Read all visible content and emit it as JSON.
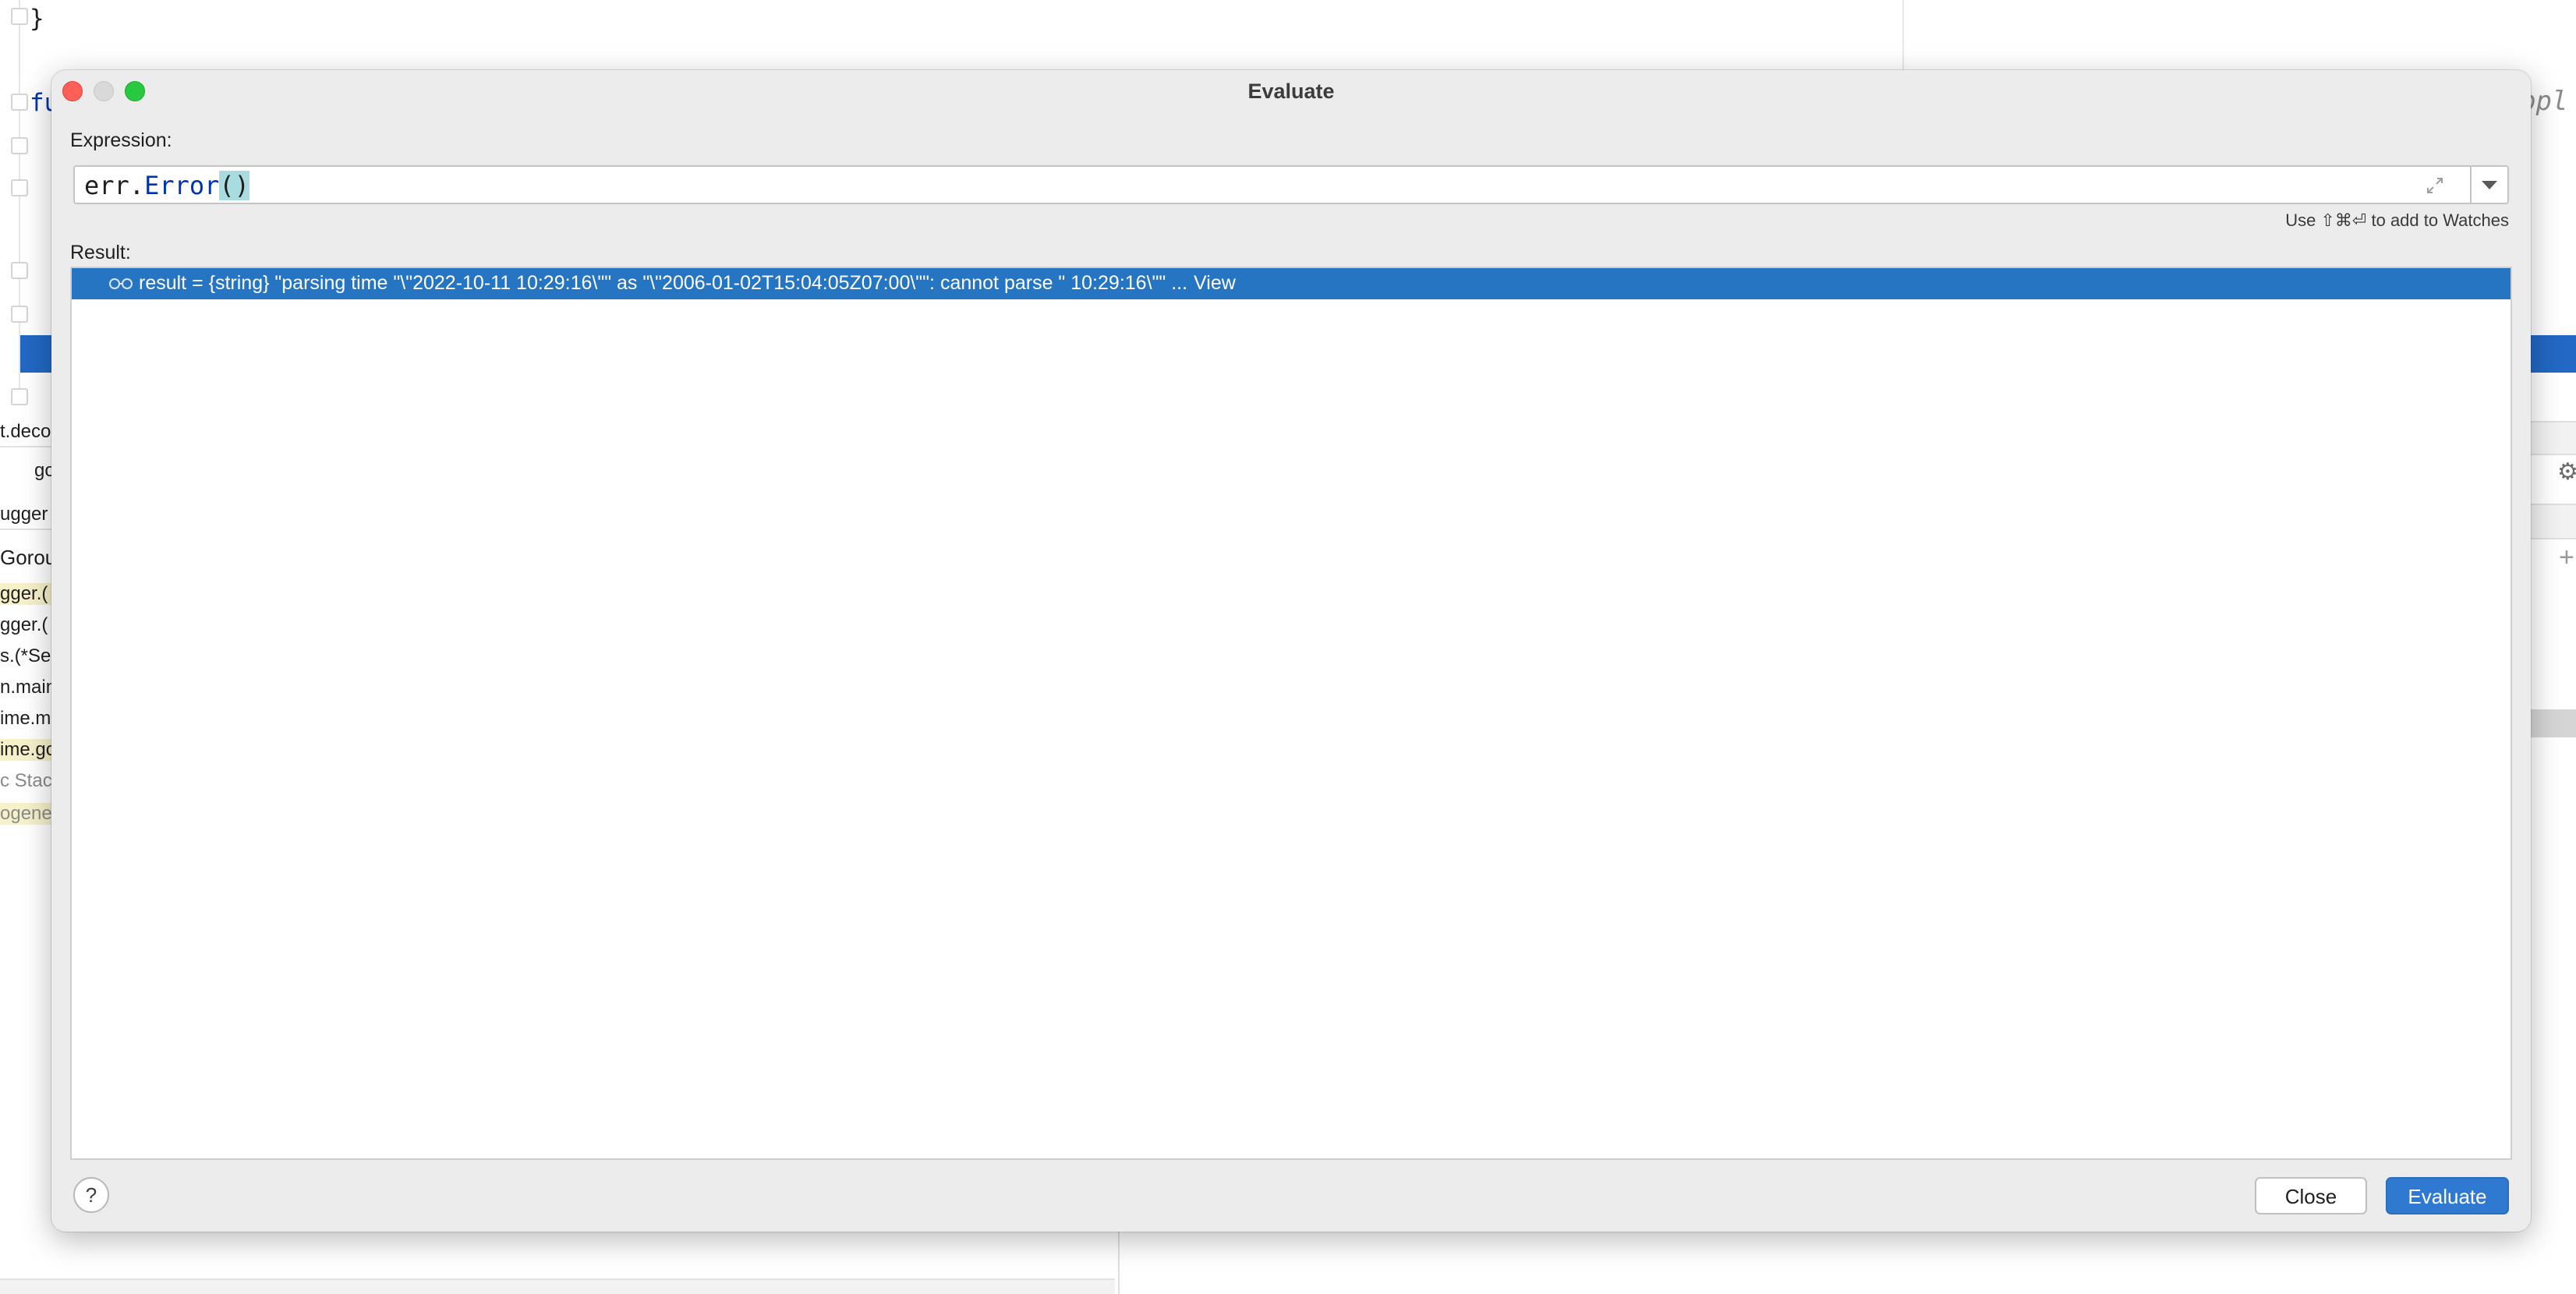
{
  "background_ide": {
    "code_brace": "}",
    "code_keyword_fragment": "fu",
    "ghost_text_right": "ppl",
    "left_panel_items": [
      {
        "label": "t.deco",
        "style": "plain"
      },
      {
        "label": "go",
        "style": "plain"
      },
      {
        "label": "ugger",
        "style": "plain"
      },
      {
        "label": "Gorout",
        "style": "plain"
      },
      {
        "label": "gger.(",
        "style": "highlight"
      },
      {
        "label": "gger.(",
        "style": "plain"
      },
      {
        "label": "s.(*Se",
        "style": "plain"
      },
      {
        "label": "n.main",
        "style": "plain"
      },
      {
        "label": "ime.m",
        "style": "plain"
      },
      {
        "label": "ime.go",
        "style": "highlight"
      },
      {
        "label": "c Stac",
        "style": "dim"
      },
      {
        "label": "ogene",
        "style": "dim"
      }
    ],
    "right_gear_icon": "gear-icon",
    "right_plus_icon": "plus-icon"
  },
  "dialog": {
    "title": "Evaluate",
    "expression_label": "Expression:",
    "expression": {
      "prefix": "err.",
      "method": "Error",
      "call_parens": "()"
    },
    "watches_hint": "Use ⇧⌘⏎ to add to Watches",
    "result_label": "Result:",
    "result": {
      "icon": "watch-glasses-icon",
      "text": "result = {string} \"parsing time \"\\\"2022-10-11 10:29:16\\\"\" as \"\\\"2006-01-02T15:04:05Z07:00\\\"\": cannot parse \" 10:29:16\\\"\" ...",
      "view_link": "View"
    },
    "help_button": "?",
    "close_button": "Close",
    "evaluate_button": "Evaluate"
  },
  "colors": {
    "selection_blue": "#2675c2",
    "primary_button": "#2f7ad0",
    "dialog_bg": "#ececec",
    "traffic_close": "#fe5f57",
    "traffic_max": "#28c840"
  }
}
